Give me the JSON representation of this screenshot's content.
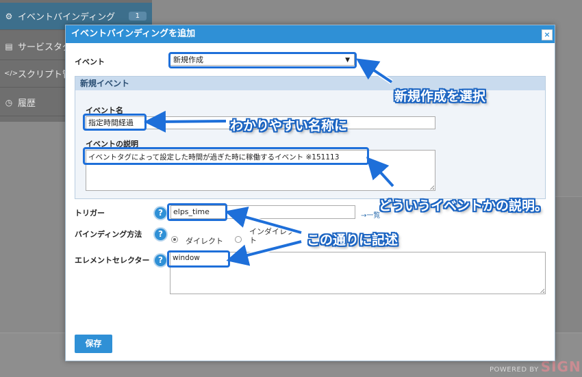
{
  "background": {
    "sidebar": [
      {
        "icon": "gear-icon",
        "label": "イベントバインディング",
        "count": "1"
      },
      {
        "icon": "document-icon",
        "label": "サービスタグ"
      },
      {
        "icon": "code-icon",
        "label": "スクリプト管理"
      },
      {
        "icon": "clock-icon",
        "label": "履歴"
      }
    ],
    "powered_by": "POWERED BY",
    "brand": "SIGN"
  },
  "dialog": {
    "title": "イベントバインディングを追加",
    "close_glyph": "×",
    "event": {
      "label": "イベント",
      "selected": "新規作成"
    },
    "fieldset": {
      "legend": "新規イベント",
      "name_label": "イベント名",
      "name_value": "指定時間経過",
      "description_label": "イベントの説明",
      "description_value": "イベントタグによって設定した時間が過ぎた時に稼働するイベント ※151113"
    },
    "trigger": {
      "label": "トリガー",
      "value": "elps_time",
      "list_link": "一覧"
    },
    "binding": {
      "label": "バインディング方法",
      "option_direct": "ダイレクト",
      "option_indirect": "インダイレクト"
    },
    "selector": {
      "label": "エレメントセレクター",
      "value": "window"
    },
    "save_label": "保存"
  },
  "annotations": {
    "select_new": "新規作成を選択",
    "easy_name": "わかりやすい名称に",
    "description": "どういうイベントかの説明。",
    "write_as_is": "この通りに記述"
  },
  "colors": {
    "accent": "#2f90d6",
    "annotation": "#1e6fd9"
  }
}
